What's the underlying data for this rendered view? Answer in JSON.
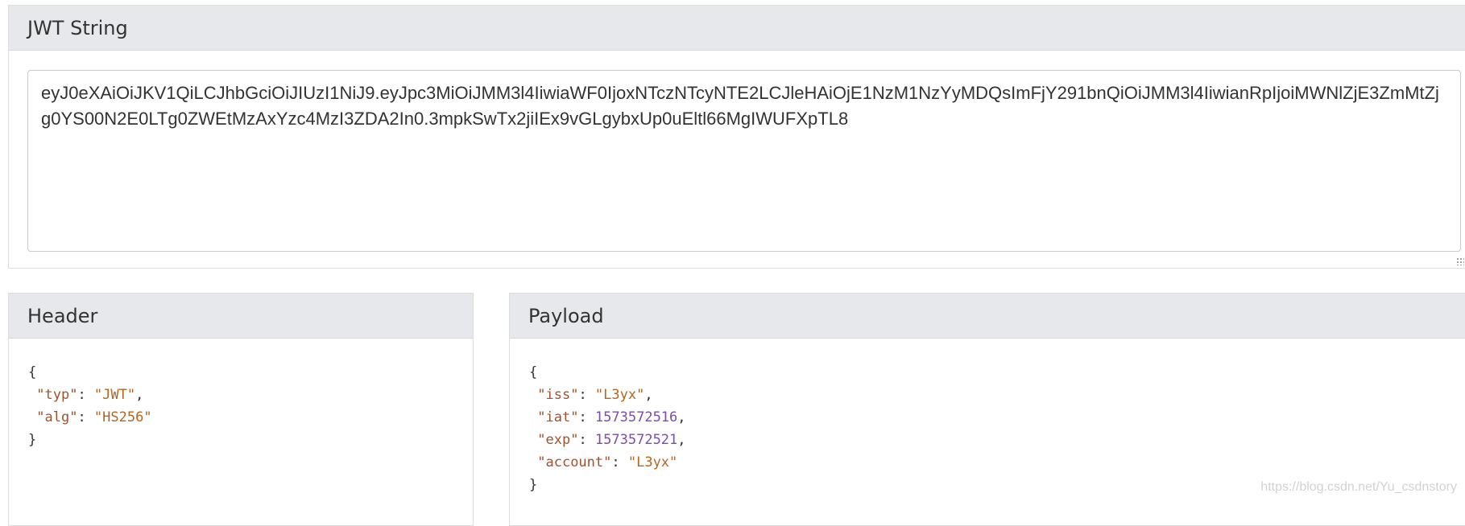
{
  "jwt_panel": {
    "title": "JWT String",
    "value": "eyJ0eXAiOiJKV1QiLCJhbGciOiJIUzI1NiJ9.eyJpc3MiOiJMM3l4IiwiaWF0IjoxNTczNTcyNTE2LCJleHAiOjE1NzM1NzYyMDQsImFjY291bnQiOiJMM3l4IiwianRpIjoiMWNlZjE3ZmMtZjg0YS00N2E0LTg0ZWEtMzAxYzc4MzI3ZDA2In0.3mpkSwTx2jiIEx9vGLgybxUp0uEltl66MgIWUFXpTL8"
  },
  "header_panel": {
    "title": "Header",
    "brace_open": "{",
    "brace_close": "}",
    "fields": [
      {
        "key": "\"typ\"",
        "value": "\"JWT\"",
        "sep": ",",
        "kind": "string"
      },
      {
        "key": "\"alg\"",
        "value": "\"HS256\"",
        "sep": "",
        "kind": "string"
      }
    ]
  },
  "payload_panel": {
    "title": "Payload",
    "brace_open": "{",
    "brace_close": "}",
    "fields": [
      {
        "key": "\"iss\"",
        "value": "\"L3yx\"",
        "sep": ",",
        "kind": "string"
      },
      {
        "key": "\"iat\"",
        "value": "1573572516",
        "sep": ",",
        "kind": "number"
      },
      {
        "key": "\"exp\"",
        "value": "1573572521",
        "sep": ",",
        "kind": "number"
      },
      {
        "key": "\"account\"",
        "value": "\"L3yx\"",
        "sep": "",
        "kind": "string"
      }
    ]
  },
  "watermark": "https://blog.csdn.net/Yu_csdnstory",
  "colors": {
    "key": "#a0522d",
    "string": "#b5651d",
    "number": "#7a4ea8",
    "heading_bg": "#e7e8eb"
  }
}
